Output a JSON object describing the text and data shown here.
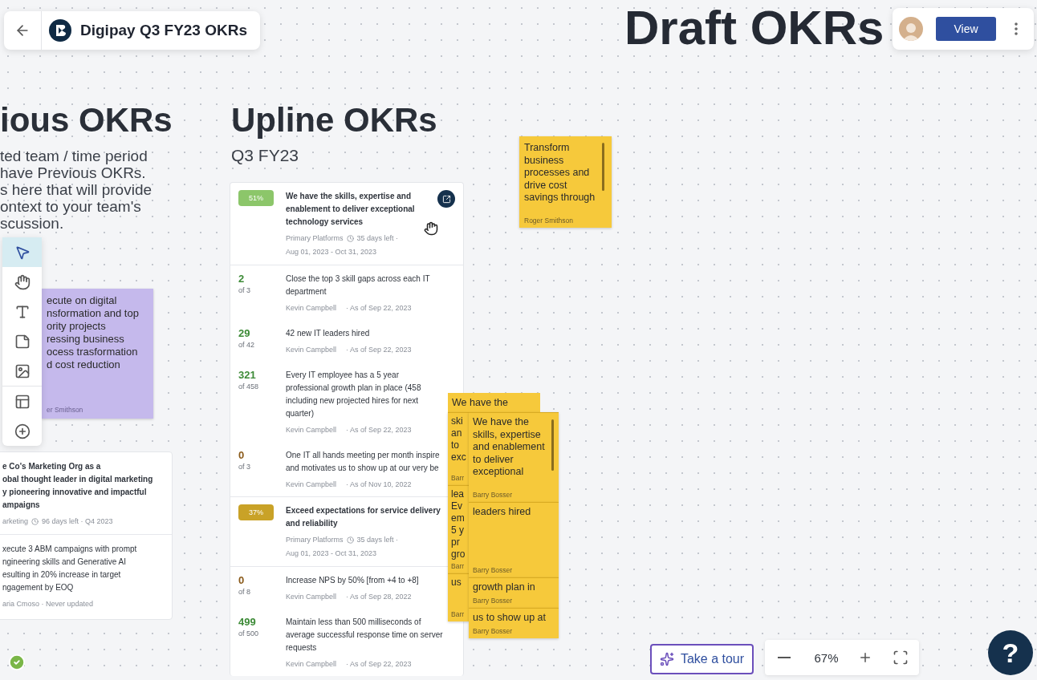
{
  "header": {
    "title": "Digipay Q3 FY23 OKRs"
  },
  "top_bar": {
    "view_button": "View"
  },
  "draft_heading": "Draft OKRs",
  "previous": {
    "title": "ious OKRs",
    "description": "ted team / time period\nhave Previous OKRs.\ns here that will provide\nontext to your team's\nscussion.",
    "sticky": {
      "text": "ecute on digital\nnsformation and top\nority projects\nressing business\nocess trasformation\nd cost reduction",
      "author": "er Smithson"
    },
    "card": {
      "objective": {
        "title": "e Co's Marketing Org as a\nobal thought leader in digital marketing\ny pioneering innovative and impactful\nampaigns",
        "team": "arketing",
        "days_left": "96 days left · Q4 2023"
      },
      "key_result": {
        "title": "xecute 3 ABM campaigns with prompt\nngineering skills and Generative AI\nesulting in 20% increase in target\nngagement by EOQ",
        "meta": "aria Cmoso · Never updated"
      }
    }
  },
  "toolbar": {
    "tools": [
      {
        "kind": "select",
        "selected": true
      },
      {
        "kind": "hand",
        "selected": false
      },
      {
        "kind": "text",
        "selected": false
      },
      {
        "kind": "note",
        "selected": false
      },
      {
        "kind": "image",
        "selected": false
      },
      {
        "kind": "layout",
        "selected": false
      },
      {
        "kind": "add",
        "selected": false
      }
    ]
  },
  "upline": {
    "title": "Upline OKRs",
    "period": "Q3 FY23",
    "items": [
      {
        "kind": "objective",
        "progress": "51%",
        "color": "#8cc66a",
        "title": "We have the skills, expertise and enablement to deliver exceptional technology services",
        "team": "Primary Platforms",
        "days_left": "35 days left ·",
        "dates": "Aug 01, 2023 - Oct 31, 2023",
        "hovered": true
      },
      {
        "kind": "key_result",
        "value": "2",
        "target": "of 3",
        "color": "#3d8b37",
        "title": "Close the top 3 skill gaps across each IT department",
        "owner": "Kevin Campbell",
        "as_of": "· As of Sep 22, 2023"
      },
      {
        "kind": "key_result",
        "value": "29",
        "target": "of 42",
        "color": "#3d8b37",
        "title": "42 new IT leaders hired",
        "owner": "Kevin Campbell",
        "as_of": "· As of Sep 22, 2023"
      },
      {
        "kind": "key_result",
        "value": "321",
        "target": "of 458",
        "color": "#3d8b37",
        "title": "Every IT employee has a 5 year professional growth plan in place (458 including new projected hires for next quarter)",
        "owner": "Kevin Campbell",
        "as_of": "· As of Sep 22, 2023"
      },
      {
        "kind": "key_result",
        "value": "0",
        "target": "of 3",
        "color": "#8a5a1a",
        "title": "One IT all hands meeting per month inspire\nand motivates us to show up at our very be",
        "owner": "Kevin Campbell",
        "as_of": "· As of Nov 10, 2022"
      },
      {
        "kind": "objective",
        "progress": "37%",
        "color": "#c9a227",
        "title": "Exceed expectations for service delivery and reliability",
        "team": "Primary Platforms",
        "days_left": "35 days left ·",
        "dates": "Aug 01, 2023 - Oct 31, 2023",
        "hovered": false
      },
      {
        "kind": "key_result",
        "value": "0",
        "target": "of 8",
        "color": "#8a5a1a",
        "title": "Increase NPS by 50% [from +4 to +8]",
        "owner": "Kevin Campbell",
        "as_of": "· As of Sep 28, 2022"
      },
      {
        "kind": "key_result",
        "value": "499",
        "target": "of 500",
        "color": "#3d8b37",
        "title": "Maintain less than 500 milliseconds of average successful response time on server requests",
        "owner": "Kevin Campbell",
        "as_of": "· As of Sep 22, 2023"
      }
    ]
  },
  "sticky": {
    "text": "Transform business processes and drive cost savings through",
    "author": "Roger Smithson"
  },
  "sticky_stack": {
    "back": [
      {
        "first_line": "We have the",
        "fragment": "ski\nan\nto\nexc",
        "author": "Barr"
      },
      {
        "fragment": "lea\nEv\nem\n5 y\npr\ngro",
        "author": "Barr"
      },
      {
        "fragment": "us",
        "author": "Barr"
      }
    ],
    "front": [
      {
        "text": "We have the skills, expertise and enablement to deliver exceptional",
        "author": "Barry Bosser"
      },
      {
        "text": "leaders hired",
        "author": "Barry Bosser"
      },
      {
        "text": "growth plan in",
        "author": "Barry Bosser"
      },
      {
        "text": "us to show up at",
        "author": "Barry Bosser"
      }
    ]
  },
  "bottom": {
    "tour_button": "Take a tour",
    "zoom": "67%",
    "help": "?"
  }
}
